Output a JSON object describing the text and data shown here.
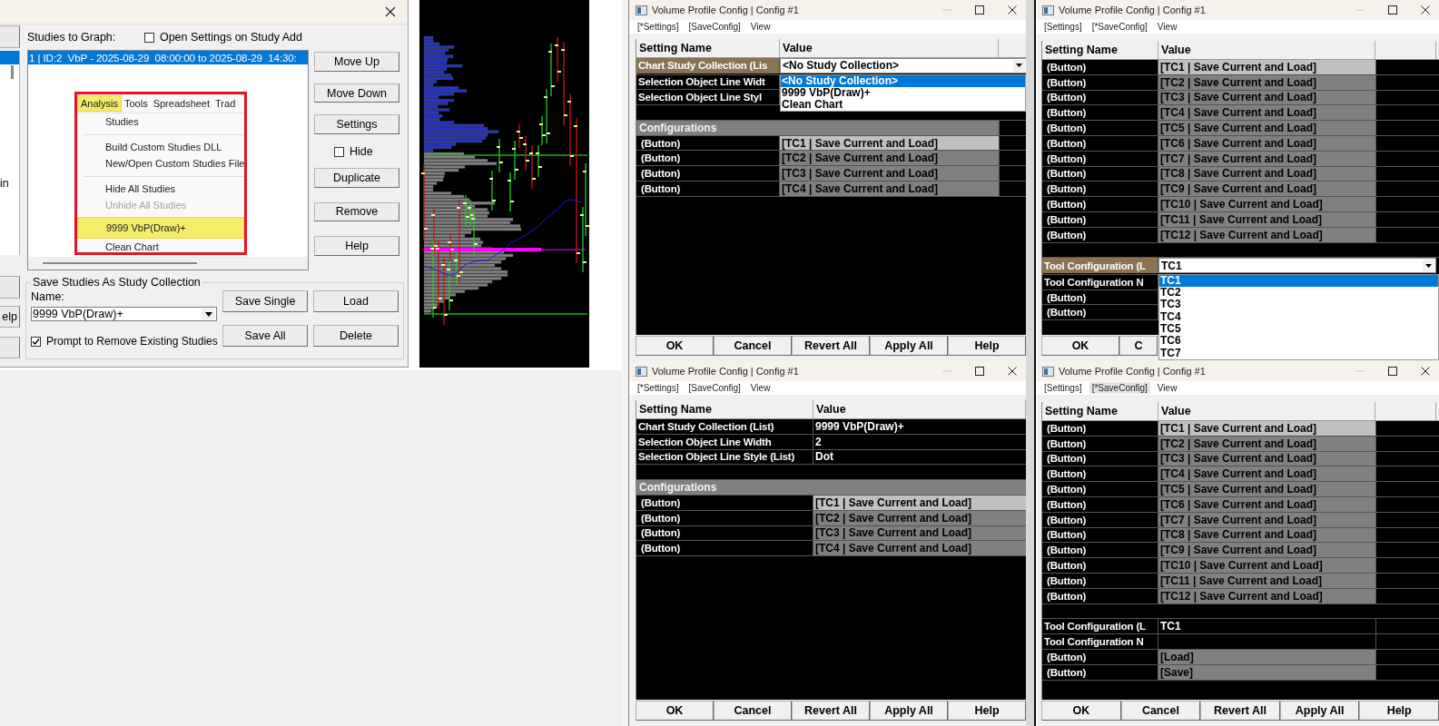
{
  "study_dialog": {
    "left_panel": {
      "list_item": "in",
      "button_label": "elp"
    },
    "studies_label": "Studies to Graph:",
    "open_settings": {
      "label": "Open Settings on Study Add",
      "checked": false
    },
    "studies": [
      {
        "text": "1 | ID:2  VbP - 2025-08-29  08:00:00 to 2025-08-29  14:30:",
        "selected": true
      }
    ],
    "menu_overlay": {
      "menus": [
        {
          "label": "Analysis",
          "selected": true
        },
        {
          "label": "Tools",
          "selected": false
        },
        {
          "label": "Spreadsheet",
          "selected": false
        },
        {
          "label": "Trad",
          "selected": false
        }
      ],
      "items": [
        {
          "kind": "item",
          "label": "Studies",
          "disabled": false,
          "highlighted": false
        },
        {
          "kind": "separator"
        },
        {
          "kind": "item",
          "label": "Build Custom Studies DLL",
          "disabled": false,
          "highlighted": false
        },
        {
          "kind": "item",
          "label": "New/Open Custom Studies File",
          "disabled": false,
          "highlighted": false
        },
        {
          "kind": "separator"
        },
        {
          "kind": "item",
          "label": "Hide All Studies",
          "disabled": false,
          "highlighted": false
        },
        {
          "kind": "item",
          "label": "Unhide All Studies",
          "disabled": true,
          "highlighted": false
        },
        {
          "kind": "item",
          "label": "9999 VbP(Draw)+",
          "disabled": false,
          "highlighted": true
        },
        {
          "kind": "item",
          "label": "Clean Chart",
          "disabled": false,
          "highlighted": false
        }
      ]
    },
    "side_controls": [
      {
        "kind": "button",
        "label": "Move Up"
      },
      {
        "kind": "button",
        "label": "Move Down"
      },
      {
        "kind": "button",
        "label": "Settings"
      },
      {
        "kind": "checkbox",
        "label": "Hide",
        "checked": false
      },
      {
        "kind": "button",
        "label": "Duplicate"
      },
      {
        "kind": "button",
        "label": "Remove"
      },
      {
        "kind": "button",
        "label": "Help"
      }
    ],
    "collection": {
      "title": "Save Studies As Study Collection",
      "name_label": "Name:",
      "name_value": "9999 VbP(Draw)+",
      "buttons": [
        "Save Single",
        "Load",
        "Save All",
        "Delete"
      ],
      "prompt": {
        "label": "Prompt to Remove Existing Studies",
        "checked": true
      }
    }
  },
  "config_windows": [
    {
      "title": "Volume Profile Config | Config #1",
      "menu": [
        {
          "label": "[*Settings]",
          "selected": false
        },
        {
          "label": "[SaveConfig]",
          "selected": false
        },
        {
          "label": "View",
          "selected": false
        }
      ],
      "columns": [
        "Setting Name",
        "Value"
      ],
      "rows": [
        {
          "kind": "combo",
          "name": "Chart Study Collection (Lis",
          "value": "<No Study Collection>",
          "options": [
            {
              "label": "<No Study Collection>",
              "selected": true
            },
            {
              "label": "9999 VbP(Draw)+",
              "selected": false
            },
            {
              "label": "Clean Chart",
              "selected": false
            }
          ]
        },
        {
          "kind": "setting",
          "name": "Selection Object Line Widt"
        },
        {
          "kind": "setting",
          "name": "Selection Object Line Styl"
        },
        {
          "kind": "blank"
        },
        {
          "kind": "section",
          "name": "Configurations"
        },
        {
          "kind": "button",
          "name": "(Button)",
          "value": "[TC1 | Save Current and Load]",
          "active": true
        },
        {
          "kind": "button",
          "name": "(Button)",
          "value": "[TC2 | Save Current and Load]",
          "active": false
        },
        {
          "kind": "button",
          "name": "(Button)",
          "value": "[TC3 | Save Current and Load]",
          "active": false
        },
        {
          "kind": "button",
          "name": "(Button)",
          "value": "[TC4 | Save Current and Load]",
          "active": false
        }
      ],
      "buttons": [
        "OK",
        "Cancel",
        "Revert All",
        "Apply All",
        "Help"
      ]
    },
    {
      "title": "Volume Profile Config | Config #1",
      "menu": [
        {
          "label": "[Settings]",
          "selected": false
        },
        {
          "label": "[*SaveConfig]",
          "selected": false
        },
        {
          "label": "View",
          "selected": false
        }
      ],
      "columns": [
        "Setting Name",
        "Value"
      ],
      "rows": [
        {
          "kind": "button",
          "name": "(Button)",
          "value": "[TC1 | Save Current and Load]",
          "active": true
        },
        {
          "kind": "button",
          "name": "(Button)",
          "value": "[TC2 | Save Current and Load]",
          "active": false
        },
        {
          "kind": "button",
          "name": "(Button)",
          "value": "[TC3 | Save Current and Load]",
          "active": false
        },
        {
          "kind": "button",
          "name": "(Button)",
          "value": "[TC4 | Save Current and Load]",
          "active": false
        },
        {
          "kind": "button",
          "name": "(Button)",
          "value": "[TC5 | Save Current and Load]",
          "active": false
        },
        {
          "kind": "button",
          "name": "(Button)",
          "value": "[TC6 | Save Current and Load]",
          "active": false
        },
        {
          "kind": "button",
          "name": "(Button)",
          "value": "[TC7 | Save Current and Load]",
          "active": false
        },
        {
          "kind": "button",
          "name": "(Button)",
          "value": "[TC8 | Save Current and Load]",
          "active": false
        },
        {
          "kind": "button",
          "name": "(Button)",
          "value": "[TC9 | Save Current and Load]",
          "active": false
        },
        {
          "kind": "button",
          "name": "(Button)",
          "value": "[TC10 | Save Current and Load]",
          "active": false
        },
        {
          "kind": "button",
          "name": "(Button)",
          "value": "[TC11 | Save Current and Load]",
          "active": false
        },
        {
          "kind": "button",
          "name": "(Button)",
          "value": "[TC12 | Save Current and Load]",
          "active": false
        },
        {
          "kind": "blank"
        },
        {
          "kind": "combo",
          "name": "Tool Configuration (L",
          "value": "TC1",
          "options": [
            {
              "label": "TC1",
              "selected": true
            },
            {
              "label": "TC2",
              "selected": false
            },
            {
              "label": "TC3",
              "selected": false
            },
            {
              "label": "TC4",
              "selected": false
            },
            {
              "label": "TC5",
              "selected": false
            },
            {
              "label": "TC6",
              "selected": false
            },
            {
              "label": "TC7",
              "selected": false
            }
          ]
        },
        {
          "kind": "setting",
          "name": "Tool Configuration N"
        },
        {
          "kind": "button",
          "name": "(Button)"
        },
        {
          "kind": "button",
          "name": "(Button)"
        }
      ],
      "buttons": [
        "OK",
        "C"
      ]
    },
    {
      "title": "Volume Profile Config | Config #1",
      "menu": [
        {
          "label": "[*Settings]",
          "selected": false
        },
        {
          "label": "[SaveConfig]",
          "selected": false
        },
        {
          "label": "View",
          "selected": false
        }
      ],
      "columns": [
        "Setting Name",
        "Value"
      ],
      "rows": [
        {
          "kind": "setting",
          "name": "Chart Study Collection (List)",
          "value": "9999 VbP(Draw)+"
        },
        {
          "kind": "setting",
          "name": "Selection Object Line Width",
          "value": "2"
        },
        {
          "kind": "setting",
          "name": "Selection Object Line Style (List)",
          "value": "Dot"
        },
        {
          "kind": "blank"
        },
        {
          "kind": "section",
          "name": "Configurations"
        },
        {
          "kind": "button",
          "name": "(Button)",
          "value": "[TC1 | Save Current and Load]",
          "active": true
        },
        {
          "kind": "button",
          "name": "(Button)",
          "value": "[TC2 | Save Current and Load]",
          "active": false
        },
        {
          "kind": "button",
          "name": "(Button)",
          "value": "[TC3 | Save Current and Load]",
          "active": false
        },
        {
          "kind": "button",
          "name": "(Button)",
          "value": "[TC4 | Save Current and Load]",
          "active": false
        }
      ],
      "buttons": [
        "OK",
        "Cancel",
        "Revert All",
        "Apply All",
        "Help"
      ]
    },
    {
      "title": "Volume Profile Config | Config #1",
      "menu": [
        {
          "label": "[Settings]",
          "selected": false
        },
        {
          "label": "[*SaveConfig]",
          "selected": true
        },
        {
          "label": "View",
          "selected": false
        }
      ],
      "columns": [
        "Setting Name",
        "Value"
      ],
      "rows": [
        {
          "kind": "button",
          "name": "(Button)",
          "value": "[TC1 | Save Current and Load]",
          "active": true
        },
        {
          "kind": "button",
          "name": "(Button)",
          "value": "[TC2 | Save Current and Load]",
          "active": false
        },
        {
          "kind": "button",
          "name": "(Button)",
          "value": "[TC3 | Save Current and Load]",
          "active": false
        },
        {
          "kind": "button",
          "name": "(Button)",
          "value": "[TC4 | Save Current and Load]",
          "active": false
        },
        {
          "kind": "button",
          "name": "(Button)",
          "value": "[TC5 | Save Current and Load]",
          "active": false
        },
        {
          "kind": "button",
          "name": "(Button)",
          "value": "[TC6 | Save Current and Load]",
          "active": false
        },
        {
          "kind": "button",
          "name": "(Button)",
          "value": "[TC7 | Save Current and Load]",
          "active": false
        },
        {
          "kind": "button",
          "name": "(Button)",
          "value": "[TC8 | Save Current and Load]",
          "active": false
        },
        {
          "kind": "button",
          "name": "(Button)",
          "value": "[TC9 | Save Current and Load]",
          "active": false
        },
        {
          "kind": "button",
          "name": "(Button)",
          "value": "[TC10 | Save Current and Load]",
          "active": false
        },
        {
          "kind": "button",
          "name": "(Button)",
          "value": "[TC11 | Save Current and Load]",
          "active": false
        },
        {
          "kind": "button",
          "name": "(Button)",
          "value": "[TC12 | Save Current and Load]",
          "active": false
        },
        {
          "kind": "blank"
        },
        {
          "kind": "setting",
          "name": "Tool Configuration (L",
          "value": "TC1"
        },
        {
          "kind": "setting",
          "name": "Tool Configuration N"
        },
        {
          "kind": "button",
          "name": "(Button)",
          "value": "[Load]",
          "active": false
        },
        {
          "kind": "button",
          "name": "(Button)",
          "value": "[Save]",
          "active": false
        }
      ],
      "buttons": [
        "OK",
        "Cancel",
        "Revert All",
        "Apply All",
        "Help"
      ]
    }
  ]
}
